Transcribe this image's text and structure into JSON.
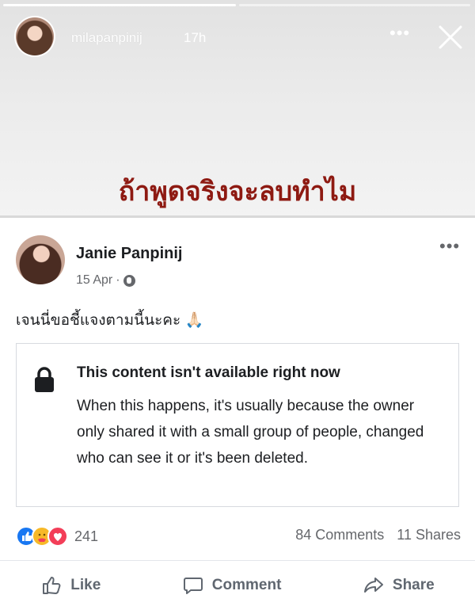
{
  "story": {
    "username": "milapanpinij",
    "time": "17h",
    "more_icon": "more-dots-icon",
    "close_icon": "close-icon",
    "caption": "ถ้าพูดจริงจะลบทำไม"
  },
  "post": {
    "author": "Janie Panpinij",
    "date": "15 Apr",
    "separator": "·",
    "privacy_icon": "globe-icon",
    "text": "เจนนี่ขอชี้แจงตามนี้นะคะ 🙏🏻",
    "unavailable": {
      "title": "This content isn't available right now",
      "body": "When this happens, it's usually because the owner only shared it with a small group of people, changed who can see it or it's been deleted."
    },
    "reaction_count": "241",
    "comments": "84 Comments",
    "shares": "11 Shares",
    "actions": {
      "like": "Like",
      "comment": "Comment",
      "share": "Share"
    }
  },
  "colors": {
    "caption": "#8e1a12",
    "like_blue": "#1877f2",
    "love_red": "#f33e58",
    "care_yellow": "#f7b928"
  }
}
